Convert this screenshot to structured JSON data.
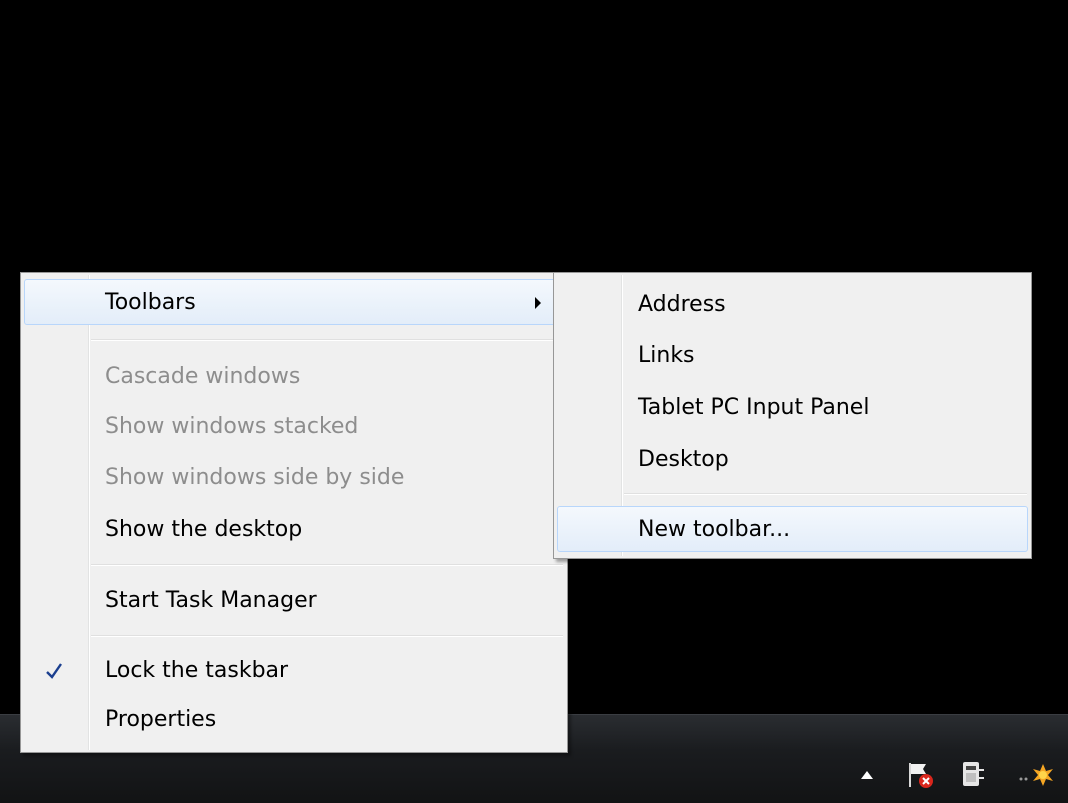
{
  "main_menu": {
    "items": [
      {
        "label": "Toolbars",
        "state": "highlighted",
        "has_submenu": true
      },
      {
        "label": "Cascade windows",
        "state": "disabled"
      },
      {
        "label": "Show windows stacked",
        "state": "disabled"
      },
      {
        "label": "Show windows side by side",
        "state": "disabled"
      },
      {
        "label": "Show the desktop",
        "state": "enabled"
      },
      {
        "label": "Start Task Manager",
        "state": "enabled"
      },
      {
        "label": "Lock the taskbar",
        "state": "enabled",
        "checked": true
      },
      {
        "label": "Properties",
        "state": "enabled"
      }
    ]
  },
  "sub_menu": {
    "items": [
      {
        "label": "Address"
      },
      {
        "label": "Links"
      },
      {
        "label": "Tablet PC Input Panel"
      },
      {
        "label": "Desktop"
      },
      {
        "label": "New toolbar...",
        "state": "highlighted"
      }
    ]
  },
  "tray": {
    "icons": [
      "show-hidden-icons-arrow-icon",
      "action-center-flag-icon",
      "power-plug-icon",
      "network-icon"
    ]
  },
  "colors": {
    "desktop": "#000000",
    "menu_background": "#f0f0f0",
    "disabled_text": "#8d8d8d",
    "highlight_border": "#b8d6fb",
    "checkmark": "#1b3f8f"
  }
}
